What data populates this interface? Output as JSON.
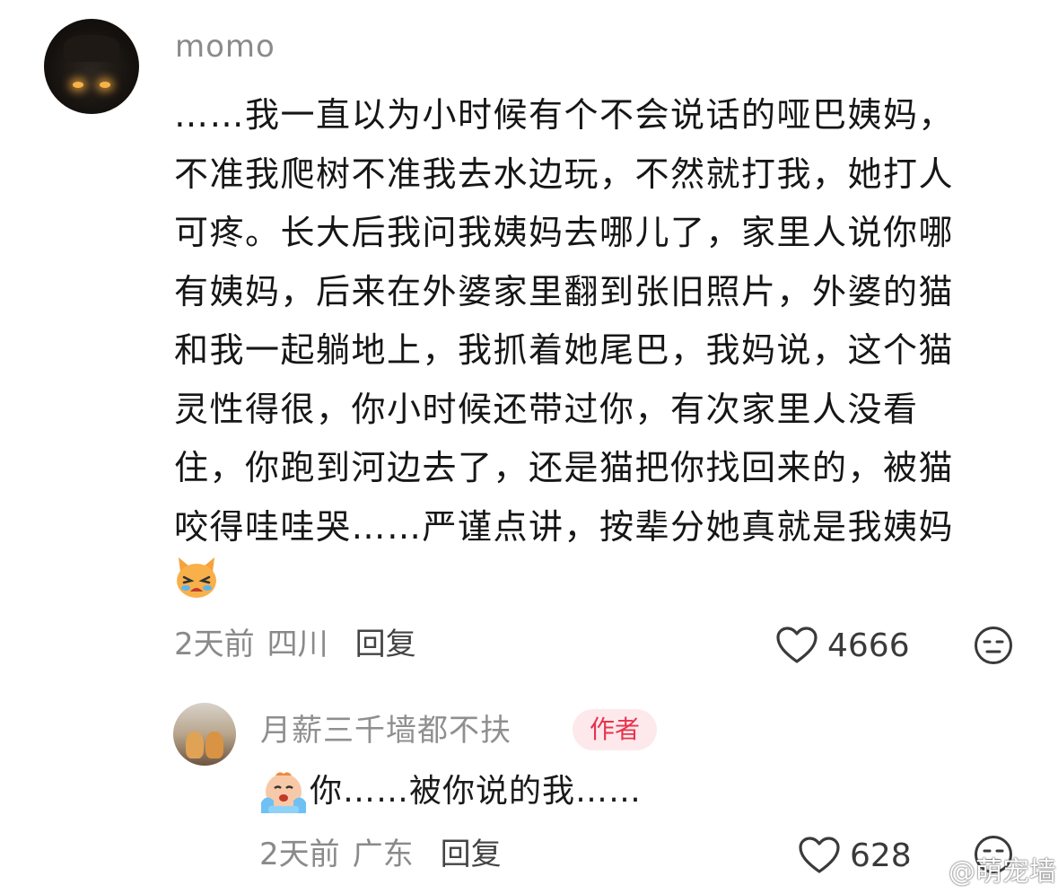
{
  "main_comment": {
    "username": "momo",
    "lines": [
      "……我一直以为小时候有个不会说话的哑巴姨妈，",
      "不准我爬树不准我去水边玩，不然就打我，她打人",
      "可疼。长大后我问我姨妈去哪儿了，家里人说你哪",
      "有姨妈，后来在外婆家里翻到张旧照片，外婆的猫",
      "和我一起躺地上，我抓着她尾巴，我妈说，这个猫",
      "灵性得很，你小时候还带过你，有次家里人没看",
      "住，你跑到河边去了，还是猫把你找回来的，被猫",
      "咬得哇哇哭……严谨点讲，按辈分她真就是我姨妈"
    ],
    "emoji": "crying-cat-emoji",
    "time": "2天前",
    "location": "四川",
    "reply_label": "回复",
    "likes": "4666"
  },
  "reply_comment": {
    "username": "月薪三千墙都不扶",
    "badge": "作者",
    "emoji": "crying-face-emoji",
    "text": "你……被你说的我……",
    "time": "2天前",
    "location": "广东",
    "reply_label": "回复",
    "likes": "628"
  },
  "watermark": {
    "text": "@萌宠墙",
    "icon": "weibo-icon"
  },
  "colors": {
    "text": "#161616",
    "meta": "#8a8a8a",
    "badge_text": "#e8334d",
    "badge_bg": "#fde9ec"
  }
}
